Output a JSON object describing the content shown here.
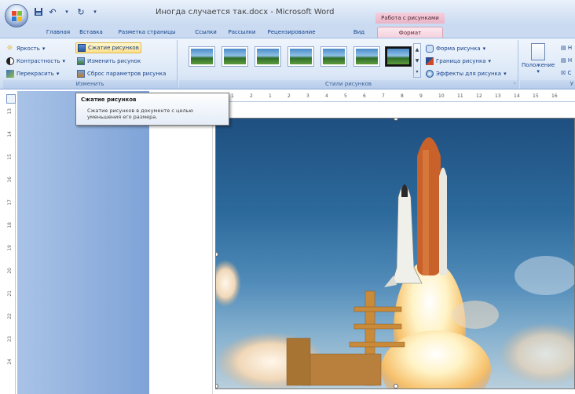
{
  "window": {
    "title": "Иногда случается так.docx - Microsoft Word",
    "context_group": "Работа с рисунками"
  },
  "tabs": [
    {
      "label": "Главная"
    },
    {
      "label": "Вставка"
    },
    {
      "label": "Разметка страницы"
    },
    {
      "label": "Ссылки"
    },
    {
      "label": "Рассылки"
    },
    {
      "label": "Рецензирование"
    },
    {
      "label": "Вид"
    },
    {
      "label": "Формат",
      "active": true
    }
  ],
  "ribbon": {
    "adjust": {
      "label": "Изменить",
      "brightness": "Яркость",
      "contrast": "Контрастность",
      "recolor": "Перекрасить",
      "compress": "Сжатие рисунков",
      "change_picture": "Изменить рисунок",
      "reset_picture": "Сброс параметров рисунка"
    },
    "styles": {
      "label": "Стили рисунков",
      "shape": "Форма рисунка",
      "border": "Граница рисунка",
      "effects": "Эффекты для рисунка"
    },
    "arrange": {
      "position": "Положение"
    }
  },
  "tooltip": {
    "title": "Сжатие рисунков",
    "desc_line1": "Сжатие рисунков в документе с целью",
    "desc_line2": "уменьшения его размера."
  },
  "ruler": {
    "h_numbers": [
      "1",
      "2",
      "1",
      "2",
      "3",
      "4",
      "5",
      "6",
      "7",
      "8",
      "9",
      "10",
      "11",
      "12",
      "13",
      "14",
      "15",
      "16"
    ],
    "v_numbers": [
      "13",
      "14",
      "15",
      "16",
      "17",
      "18",
      "19",
      "20",
      "21",
      "22",
      "23",
      "24"
    ]
  },
  "colors": {
    "ribbon_bg": "#dce8f7",
    "context_tab": "#f4d1dc",
    "workspace": "#8fb0dd"
  }
}
